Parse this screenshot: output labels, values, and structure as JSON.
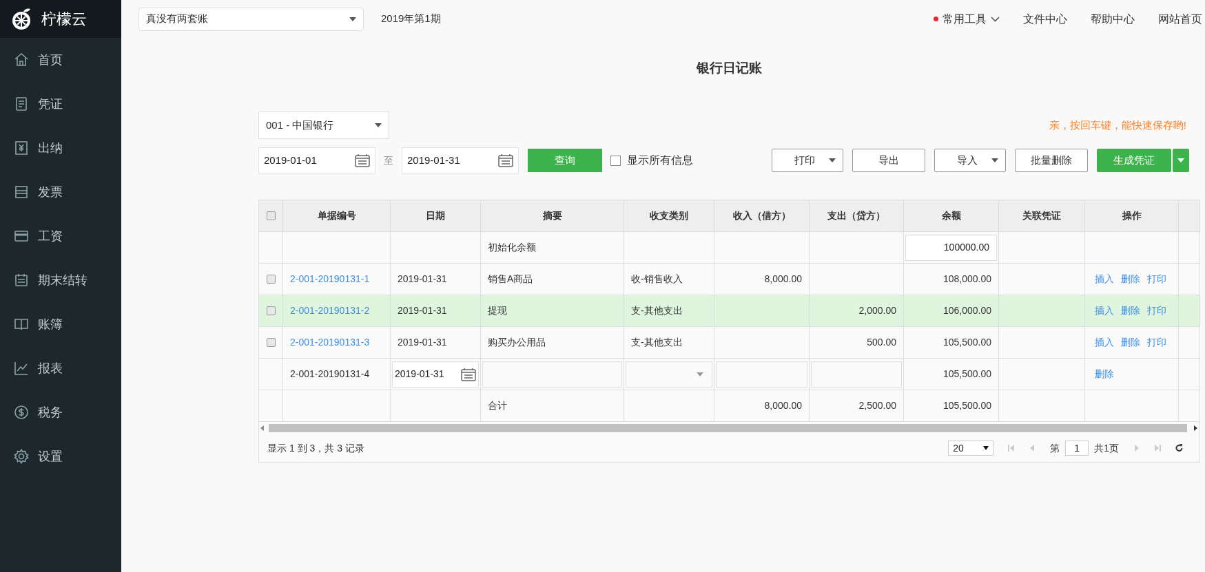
{
  "sidebar": {
    "logo": "柠檬云",
    "items": [
      {
        "label": "首页"
      },
      {
        "label": "凭证"
      },
      {
        "label": "出纳"
      },
      {
        "label": "发票"
      },
      {
        "label": "工资"
      },
      {
        "label": "期末结转"
      },
      {
        "label": "账簿"
      },
      {
        "label": "报表"
      },
      {
        "label": "税务"
      },
      {
        "label": "设置"
      }
    ]
  },
  "topbar": {
    "account_select": "真没有两套账",
    "period": "2019年第1期",
    "nav": [
      {
        "label": "常用工具",
        "kind": "menu"
      },
      {
        "label": "文件中心",
        "kind": "link"
      },
      {
        "label": "帮助中心",
        "kind": "link"
      },
      {
        "label": "网站首页",
        "kind": "link"
      }
    ]
  },
  "page_title": "银行日记账",
  "bank_select": "001 - 中国银行",
  "hint": "亲，按回车键，能快速保存哟!",
  "filters": {
    "date_from": "2019-01-01",
    "separator": "至",
    "date_to": "2019-01-31",
    "query_button": "查询",
    "show_all": {
      "label": "显示所有信息",
      "checked": false
    }
  },
  "actions": [
    {
      "label": "打印",
      "kind": "dropdown"
    },
    {
      "label": "导出",
      "kind": "plain"
    },
    {
      "label": "导入",
      "kind": "dropdown"
    },
    {
      "label": "批量删除",
      "kind": "plain"
    },
    {
      "label": "生成凭证",
      "kind": "primary_split"
    }
  ],
  "table": {
    "header_checkbox": {
      "checked": false
    },
    "columns": [
      "单据编号",
      "日期",
      "摘要",
      "收支类别",
      "收入（借方）",
      "支出（贷方）",
      "余额",
      "关联凭证",
      "操作"
    ],
    "rows": [
      {
        "kind": "opening",
        "summary": "初始化余额",
        "balance": "100000.00"
      },
      {
        "kind": "entry",
        "checked": false,
        "highlighted": false,
        "id": "2-001-20190131-1",
        "date": "2019-01-31",
        "summary": "销售A商品",
        "category": "收-销售收入",
        "income": "8,000.00",
        "balance": "108,000.00",
        "links": [
          "插入",
          "删除",
          "打印"
        ]
      },
      {
        "kind": "entry",
        "checked": false,
        "highlighted": true,
        "id": "2-001-20190131-2",
        "date": "2019-01-31",
        "summary": "提现",
        "category": "支-其他支出",
        "expense": "2,000.00",
        "balance": "106,000.00",
        "links": [
          "插入",
          "删除",
          "打印"
        ]
      },
      {
        "kind": "entry",
        "checked": false,
        "highlighted": false,
        "id": "2-001-20190131-3",
        "date": "2019-01-31",
        "summary": "购买办公用品",
        "category": "支-其他支出",
        "expense": "500.00",
        "balance": "105,500.00",
        "links": [
          "插入",
          "删除",
          "打印"
        ]
      },
      {
        "kind": "editing",
        "id": "2-001-20190131-4",
        "date": "2019-01-31",
        "balance": "105,500.00",
        "links": [
          "删除"
        ]
      },
      {
        "kind": "total",
        "summary": "合计",
        "income": "8,000.00",
        "expense": "2,500.00",
        "balance": "105,500.00"
      }
    ]
  },
  "footer": {
    "summary": "显示 1 到 3，共 3 记录",
    "page_size": "20",
    "page_prefix": "第",
    "page": "1",
    "page_total": "共1页"
  }
}
